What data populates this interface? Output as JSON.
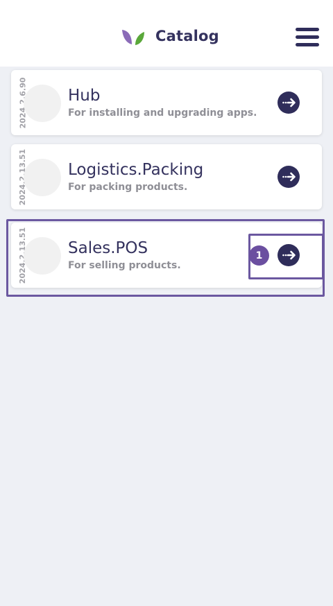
{
  "header": {
    "title": "Catalog",
    "logo_icon": "leaf-logo-icon",
    "menu_icon": "hamburger-menu-icon"
  },
  "apps": [
    {
      "version": "2024.2.6.90",
      "name": "Hub",
      "description": "For installing and upgrading apps."
    },
    {
      "version": "2024.2.13.51",
      "name": "Logistics.Packing",
      "description": "For packing products."
    },
    {
      "version": "2024.2.13.51",
      "name": "Sales.POS",
      "description": "For selling products."
    }
  ],
  "annotation": {
    "badge_label": "1",
    "highlight_color": "#6b58a0"
  },
  "colors": {
    "primary": "#2f2d5a",
    "background": "#eef0f5",
    "logo_left": "#8b6bb8",
    "logo_right": "#5aa83a"
  }
}
